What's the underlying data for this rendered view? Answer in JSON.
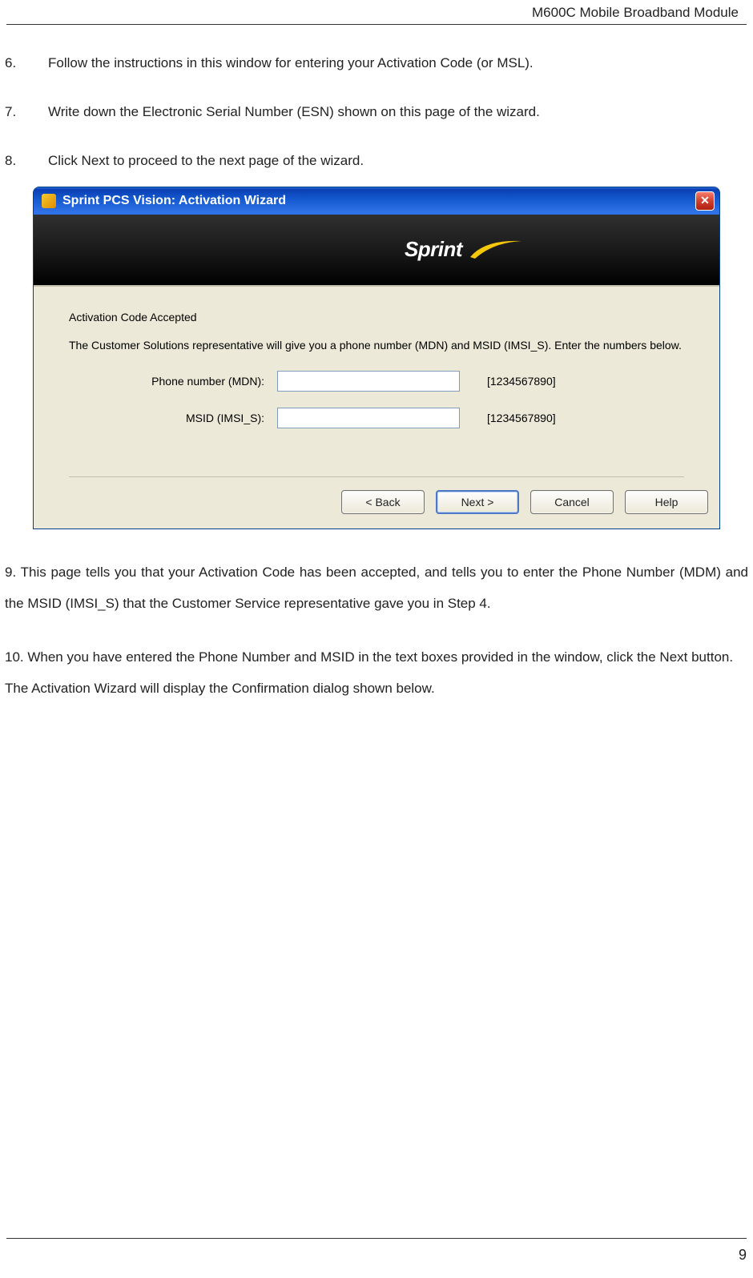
{
  "header_title": "M600C Mobile Broadband Module",
  "page_number": "9",
  "items": {
    "i6_num": "6.",
    "i6_txt": "Follow the instructions in this window for entering your Activation Code (or MSL).",
    "i7_num": "7.",
    "i7_txt": "Write down the Electronic Serial Number (ESN) shown on this page of the wizard.",
    "i8_num": "8.",
    "i8_txt": "Click Next to proceed to the next page of the wizard.",
    "i9_txt": "9.    This page tells you that your Activation Code has been accepted, and tells you to enter the Phone Number (MDM) and the MSID (IMSI_S) that the Customer Service representative gave you in Step 4.",
    "i10_txt": "10.   When you have entered the Phone Number and MSID in the text boxes provided in the window, click the Next button. The Activation Wizard will display the Confirmation dialog shown below."
  },
  "dialog": {
    "title": "Sprint PCS Vision: Activation Wizard",
    "close_glyph": "✕",
    "brand": "Sprint",
    "heading": "Activation Code Accepted",
    "instruction": "The Customer Solutions representative will give you a phone number (MDN) and MSID (IMSI_S). Enter the numbers below.",
    "field1_label": "Phone number (MDN):",
    "field1_hint": "[1234567890]",
    "field2_label": "MSID (IMSI_S):",
    "field2_hint": "[1234567890]",
    "btn_back": "< Back",
    "btn_next": "Next >",
    "btn_cancel": "Cancel",
    "btn_help": "Help"
  }
}
